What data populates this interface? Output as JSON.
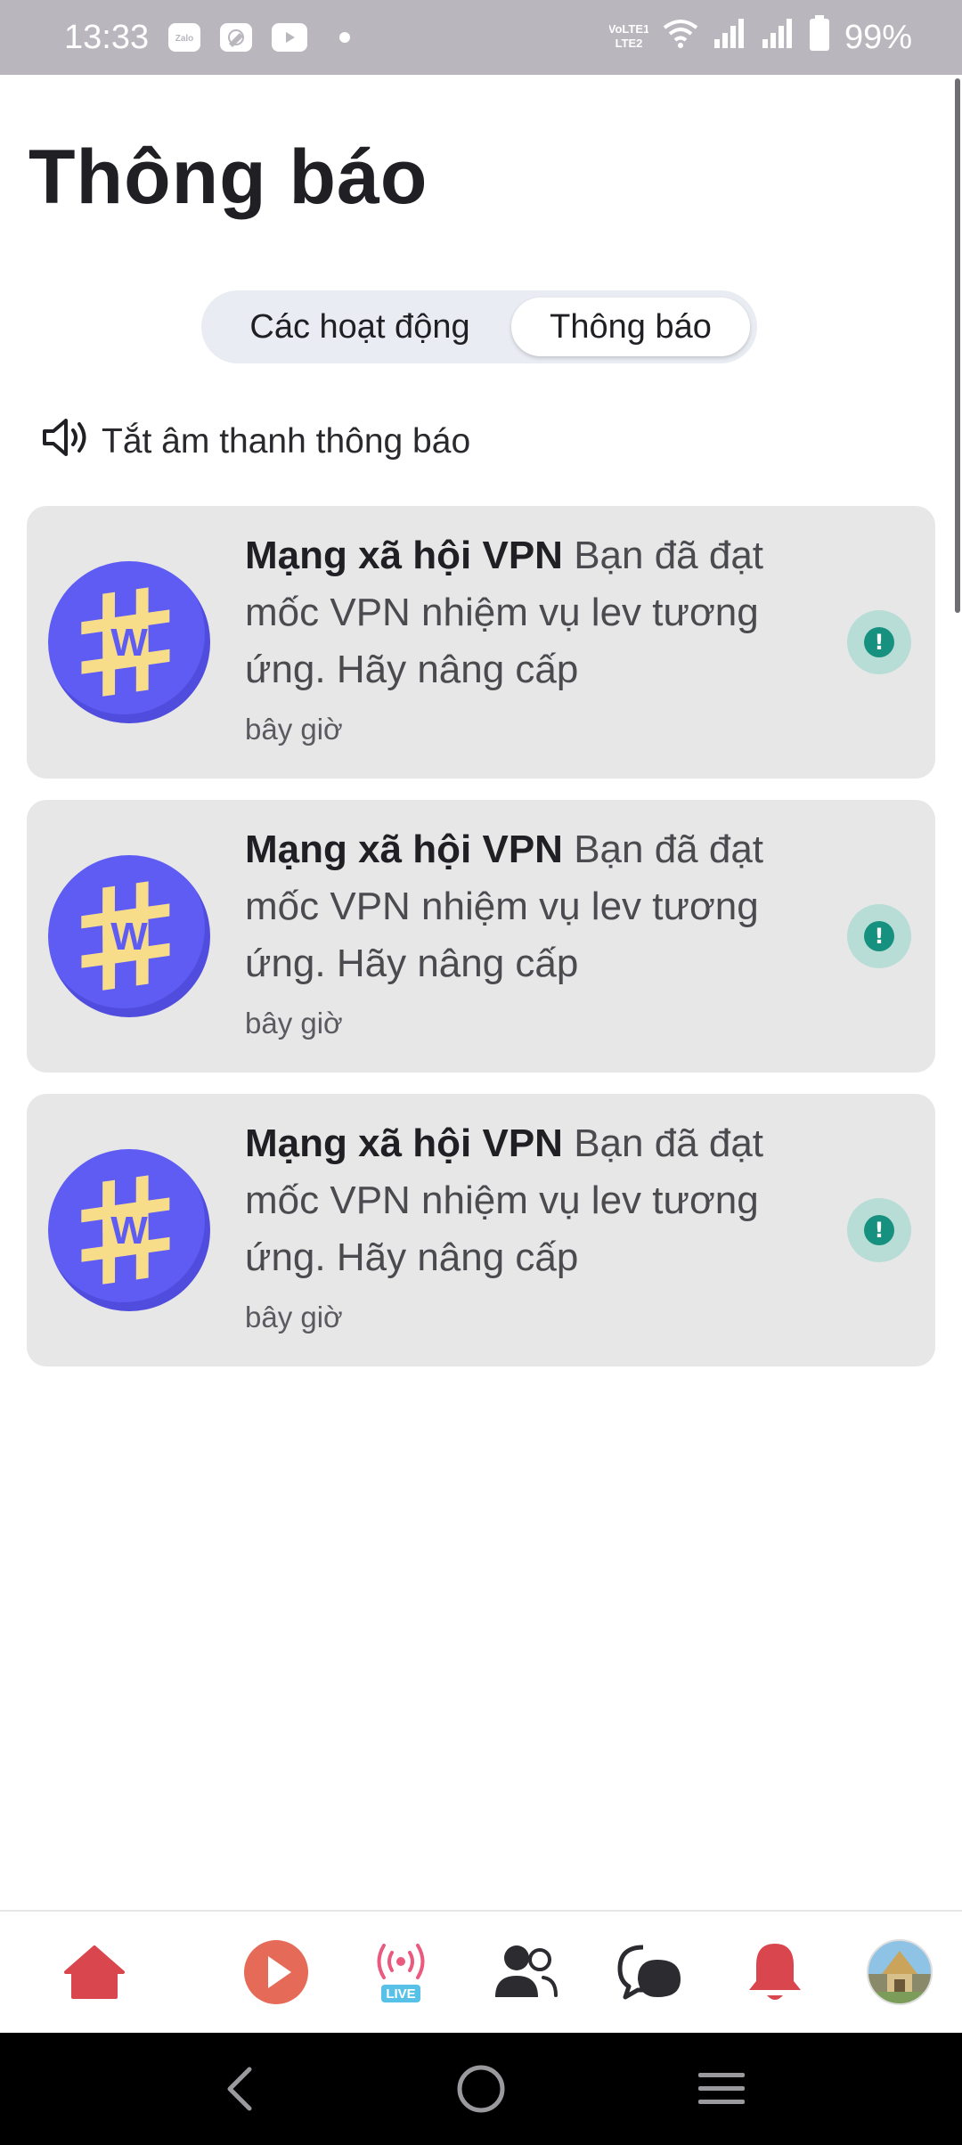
{
  "status_bar": {
    "time": "13:33",
    "app_icons": [
      "zalo-icon",
      "edit-app-icon",
      "youtube-icon"
    ],
    "network_label": "VoLTE1 LTE2",
    "battery": "99%"
  },
  "page": {
    "title": "Thông báo"
  },
  "tabs": [
    {
      "label": "Các hoạt động",
      "active": false
    },
    {
      "label": "Thông báo",
      "active": true
    }
  ],
  "mute": {
    "label": "Tắt âm thanh thông báo",
    "icon": "speaker-icon"
  },
  "notifications": [
    {
      "sender": "Mạng xã hội VPN",
      "message": "Bạn đã đạt mốc VPN nhiệm vụ lev tương ứng. Hãy nâng cấp",
      "time": "bây giờ",
      "avatar_letter": "W",
      "status_icon": "!"
    },
    {
      "sender": "Mạng xã hội VPN",
      "message": "Bạn đã đạt mốc VPN nhiệm vụ lev tương ứng. Hãy nâng cấp",
      "time": "bây giờ",
      "avatar_letter": "W",
      "status_icon": "!"
    },
    {
      "sender": "Mạng xã hội VPN",
      "message": "Bạn đã đạt mốc VPN nhiệm vụ lev tương ứng. Hãy nâng cấp",
      "time": "bây giờ",
      "avatar_letter": "W",
      "status_icon": "!"
    }
  ],
  "bottom_nav": {
    "items": [
      "home-icon",
      "play-icon",
      "live-icon",
      "friends-icon",
      "chat-icon",
      "bell-icon",
      "profile-avatar"
    ],
    "live_badge": "LIVE"
  },
  "colors": {
    "brand_red": "#e2474f",
    "avatar_purple": "#5e5cf3",
    "avatar_badge_yellow": "#f7dc8a",
    "status_teal": "#16917f",
    "card_bg": "#e7e7e8"
  }
}
